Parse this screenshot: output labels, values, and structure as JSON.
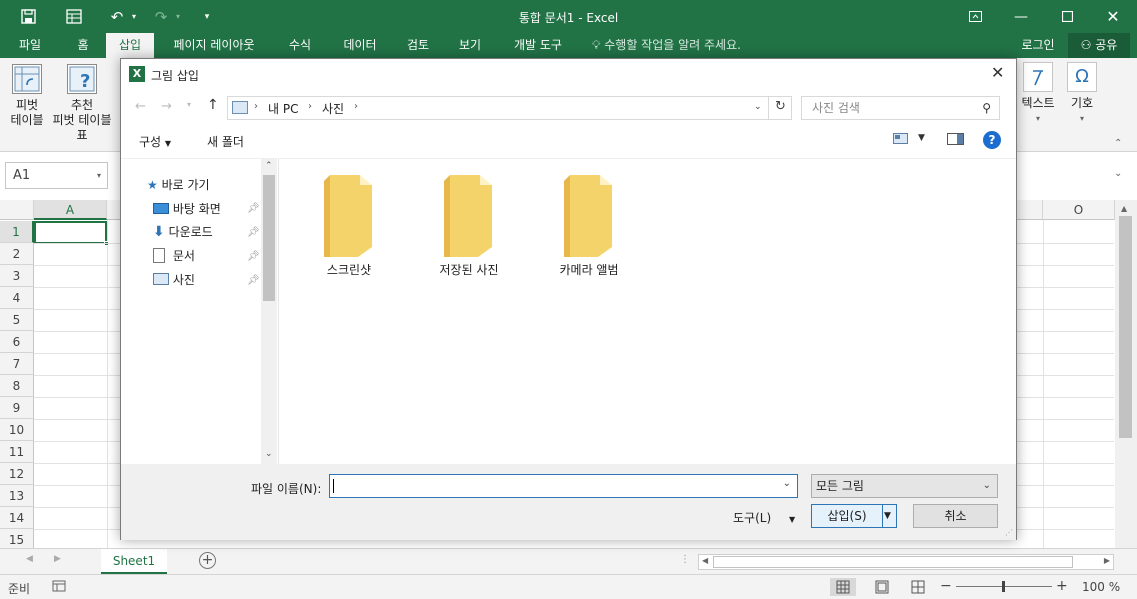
{
  "app": {
    "window_title": "통합 문서1 - Excel",
    "login": "로그인",
    "share": "공유"
  },
  "ribbon_tabs": [
    "파일",
    "홈",
    "삽입",
    "페이지 레이아웃",
    "수식",
    "데이터",
    "검토",
    "보기",
    "개발 도구"
  ],
  "tell_me": "수행할 작업을 알려 주세요.",
  "ribbon": {
    "pivot_line1": "피벗",
    "pivot_line2": "테이블",
    "rec_pivot_line1": "추천",
    "rec_pivot_line2": "피벗 테이블",
    "table_partial": "표",
    "text_label": "텍스트",
    "symbol_label": "기호"
  },
  "formula_bar": {
    "name_box": "A1"
  },
  "grid": {
    "col_a": "A",
    "col_o": "O",
    "rows": [
      "1",
      "2",
      "3",
      "4",
      "5",
      "6",
      "7",
      "8",
      "9",
      "10",
      "11",
      "12",
      "13",
      "14",
      "15"
    ]
  },
  "sheet": {
    "tab": "Sheet1"
  },
  "status": {
    "ready": "준비",
    "zoom": "100 %"
  },
  "dialog": {
    "title": "그림 삽입",
    "path": [
      "내 PC",
      "사진"
    ],
    "search_placeholder": "사진 검색",
    "organize": "구성",
    "new_folder": "새 폴더",
    "nav": {
      "quick_access": "바로 가기",
      "items": [
        "바탕 화면",
        "다운로드",
        "문서",
        "사진"
      ]
    },
    "folders": [
      "스크린샷",
      "저장된 사진",
      "카메라 앨범"
    ],
    "filename_label": "파일 이름(N):",
    "filename_value": "",
    "filter": "모든 그림",
    "tools": "도구(L)",
    "insert": "삽입(S)",
    "cancel": "취소"
  },
  "colors": {
    "excel_green": "#217346",
    "folder_yellow": "#f5d36b"
  }
}
